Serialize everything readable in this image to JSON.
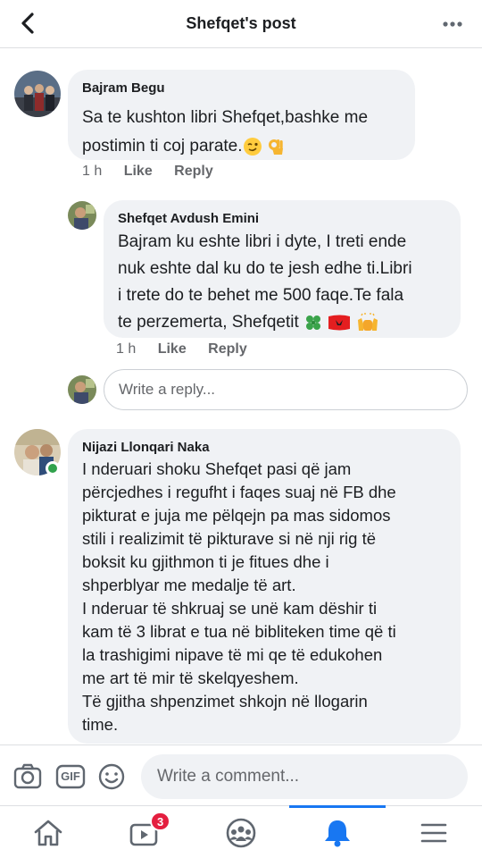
{
  "header": {
    "title": "Shefqet's post",
    "back_icon": "back-arrow-icon",
    "more_icon": "more-horizontal-icon"
  },
  "comments": [
    {
      "author": "Bajram Begu",
      "lines": [
        "Sa te kushton libri Shefqet,bashke me",
        "postimin ti coj parate."
      ],
      "emojis": [
        "winking-face-emoji",
        "ok-hand-emoji"
      ],
      "time": "1 h",
      "like_label": "Like",
      "reply_label": "Reply"
    },
    {
      "author": "Shefqet Avdush Emini",
      "lines": [
        "Bajram ku eshte libri i dyte, I treti ende",
        "nuk eshte dal ku do te jesh edhe ti.Libri",
        "i trete do te behet me 500 faqe.Te fala",
        "te perzemerta, Shefqetit"
      ],
      "emojis": [
        "four-leaf-clover-emoji",
        "albania-flag-emoji",
        "raising-hands-emoji"
      ],
      "time": "1 h",
      "like_label": "Like",
      "reply_label": "Reply"
    },
    {
      "author": "Nijazi Llonqari Naka",
      "lines": [
        "I nderuari shoku Shefqet pasi që jam",
        "përcjedhes i regufht i faqes suaj në FB dhe",
        "pikturat e juja me pëlqejn pa mas sidomos",
        "stili i realizimit të pikturave si në nji rig të",
        "boksit ku gjithmon ti je fitues dhe i",
        "shperblyar me medalje të art.",
        "I nderuar të shkruaj se unë kam dëshir ti",
        "kam të 3 librat e tua në bibliteken time që ti",
        "la trashigimi nipave të mi qe të edukohen",
        "me art të mir të skelqyeshem.",
        "Të gjitha shpenzimet shkojn në llogarin",
        "time."
      ]
    }
  ],
  "reply_box": {
    "placeholder": "Write a reply..."
  },
  "composer": {
    "placeholder": "Write a comment...",
    "icons": [
      "camera-icon",
      "gif-icon",
      "emoji-smile-icon"
    ],
    "gif_label": "GIF"
  },
  "tabbar": {
    "tabs": [
      "home-icon",
      "video-icon",
      "groups-icon",
      "notifications-bell-icon",
      "menu-icon"
    ],
    "video_badge": "3",
    "active_tab": "notifications-bell-icon",
    "accent_color": "#1877f2"
  }
}
